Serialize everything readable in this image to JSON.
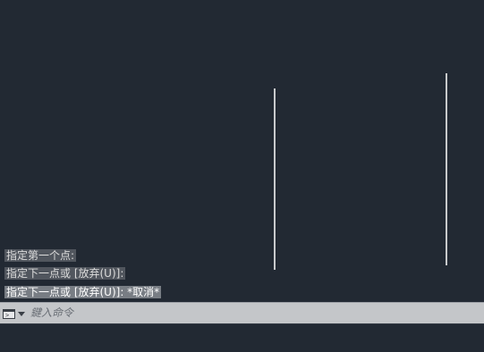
{
  "colors": {
    "background": "#222933",
    "line": "#f2f2f2",
    "command_bar": "#c4c6c9"
  },
  "history": [
    {
      "text": "指定第一个点:"
    },
    {
      "text": "指定下一点或 [放弃(U)]:"
    },
    {
      "text": "指定下一点或 [放弃(U)]: *取消*"
    }
  ],
  "command": {
    "icon": "command-prompt-icon",
    "dropdown_icon": "chevron-down-icon",
    "placeholder": "鍵入命令",
    "value": ""
  }
}
